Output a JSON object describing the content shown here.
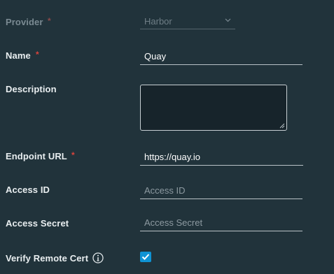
{
  "form": {
    "provider": {
      "label": "Provider",
      "required_mark": "*",
      "value": "Harbor",
      "icon": "chevron-down-icon"
    },
    "name": {
      "label": "Name",
      "required_mark": "*",
      "value": "Quay"
    },
    "description": {
      "label": "Description",
      "value": ""
    },
    "endpoint_url": {
      "label": "Endpoint URL",
      "required_mark": "*",
      "value": "https://quay.io"
    },
    "access_id": {
      "label": "Access ID",
      "placeholder": "Access ID",
      "value": ""
    },
    "access_secret": {
      "label": "Access Secret",
      "placeholder": "Access Secret",
      "value": ""
    },
    "verify_remote_cert": {
      "label": "Verify Remote Cert",
      "info_icon": "info-circle-icon",
      "checked": true
    }
  },
  "colors": {
    "background": "#21333b",
    "accent": "#0f93d4",
    "required": "#d9443c"
  }
}
